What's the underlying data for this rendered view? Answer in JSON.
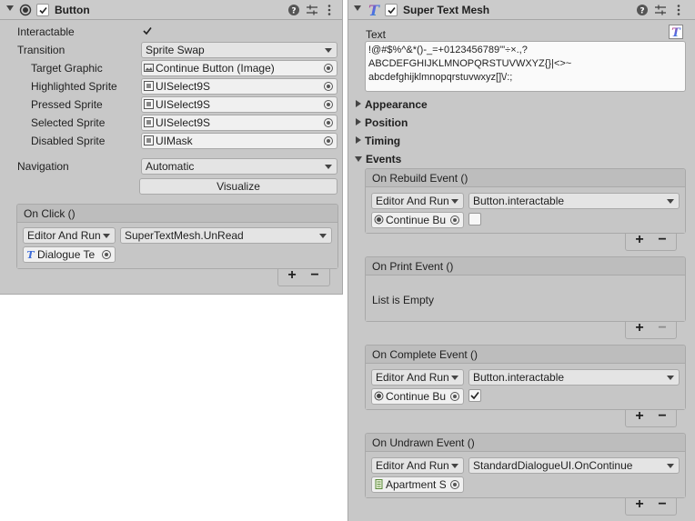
{
  "button_component": {
    "title": "Button",
    "fields": {
      "interactable_label": "Interactable",
      "transition_label": "Transition",
      "transition_value": "Sprite Swap",
      "target_graphic_label": "Target Graphic",
      "target_graphic_value": "Continue Button (Image)",
      "highlighted_sprite_label": "Highlighted Sprite",
      "highlighted_sprite_value": "UISelect9S",
      "pressed_sprite_label": "Pressed Sprite",
      "pressed_sprite_value": "UISelect9S",
      "selected_sprite_label": "Selected Sprite",
      "selected_sprite_value": "UISelect9S",
      "disabled_sprite_label": "Disabled Sprite",
      "disabled_sprite_value": "UIMask",
      "navigation_label": "Navigation",
      "navigation_value": "Automatic",
      "visualize_label": "Visualize"
    },
    "on_click": {
      "header": "On Click ()",
      "runtime": "Editor And Run",
      "function": "SuperTextMesh.UnRead",
      "object": "Dialogue Te"
    }
  },
  "super_text_mesh": {
    "title": "Super Text Mesh",
    "text_label": "Text",
    "text_lines": [
      "!@#$%^&*()-_=+0123456789'\"÷×.,?",
      "ABCDEFGHIJKLMNOPQRSTUVWXYZ{}|<>~",
      "abcdefghijklmnopqrstuvwxyz[]\\/:;"
    ],
    "sections": [
      "Appearance",
      "Position",
      "Timing",
      "Events"
    ],
    "events": {
      "on_rebuild": {
        "header": "On Rebuild Event ()",
        "runtime": "Editor And Run",
        "function": "Button.interactable",
        "object": "Continue Bu"
      },
      "on_print": {
        "header": "On Print Event ()",
        "empty_text": "List is Empty"
      },
      "on_complete": {
        "header": "On Complete Event ()",
        "runtime": "Editor And Run",
        "function": "Button.interactable",
        "object": "Continue Bu"
      },
      "on_undrawn": {
        "header": "On Undrawn Event ()",
        "runtime": "Editor And Run",
        "function": "StandardDialogueUI.OnContinue",
        "object": "Apartment S"
      }
    }
  },
  "glyphs": {
    "plus": "+",
    "minus": "−"
  }
}
